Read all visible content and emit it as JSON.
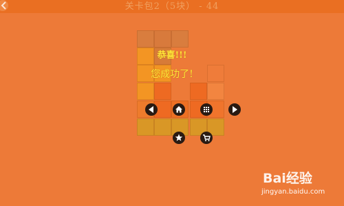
{
  "header": {
    "title": "关卡包2（5块） - 44",
    "back_icon": "left-arrow-icon"
  },
  "dialog": {
    "title": "恭喜!!!",
    "message": "您成功了!"
  },
  "controls": {
    "previous_icon": "play-left-icon",
    "home_icon": "home-icon",
    "levels_icon": "grid-icon",
    "next_icon": "play-right-icon",
    "rate_icon": "star-icon",
    "shop_icon": "cart-icon"
  },
  "watermark": {
    "logo": "Bai经验",
    "url": "jingyan.baidu.com"
  },
  "colors": {
    "background": "#ed7a38",
    "header": "#ea6f22",
    "message_text": "#ffe83a",
    "button": "#2a1a12"
  }
}
